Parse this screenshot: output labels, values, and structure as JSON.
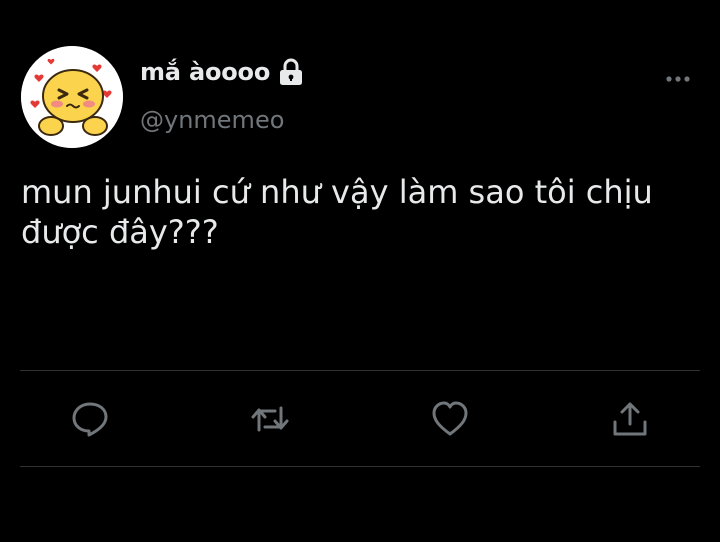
{
  "user": {
    "display_name": "mắ àoooo",
    "handle": "@ynmemeo",
    "protected_icon": "lock-icon",
    "avatar_icon": "emoji-avatar"
  },
  "tweet": {
    "text": "mun junhui cứ như vậy làm sao tôi chịu\nđược đây???"
  },
  "header": {
    "more_icon": "more-options-icon"
  },
  "actions": [
    {
      "name": "reply",
      "icon": "reply-icon"
    },
    {
      "name": "retweet",
      "icon": "retweet-icon"
    },
    {
      "name": "like",
      "icon": "heart-icon"
    },
    {
      "name": "share",
      "icon": "share-icon"
    }
  ],
  "colors": {
    "background": "#000000",
    "text_primary": "#e7e9ea",
    "text_secondary": "#71767b",
    "divider": "#2f3336"
  }
}
